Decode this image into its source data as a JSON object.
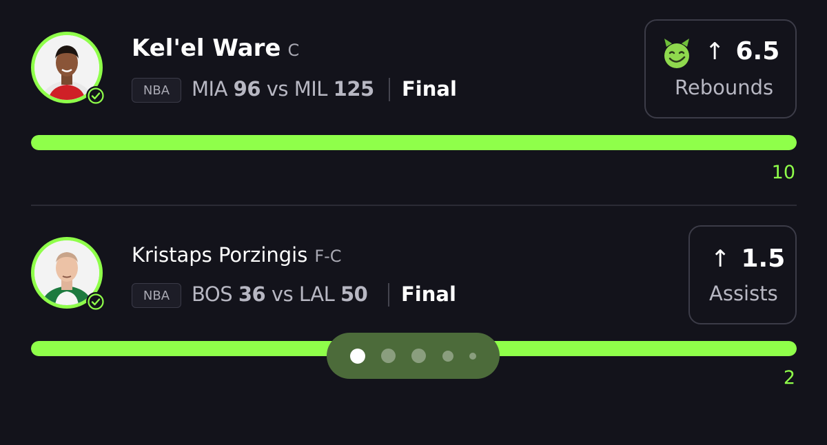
{
  "cards": [
    {
      "player": "Kel'el Ware",
      "position": "C",
      "league": "NBA",
      "team1": "MIA",
      "score1": "96",
      "vs": "vs",
      "team2": "MIL",
      "score2": "125",
      "status": "Final",
      "line": "6.5",
      "direction": "up-arrow-icon",
      "stat": "Rebounds",
      "has_emoji": true,
      "emoji_name": "smiling-devil-icon",
      "result": "10",
      "progress_fraction": 1.0
    },
    {
      "player": "Kristaps Porzingis",
      "position": "F-C",
      "league": "NBA",
      "team1": "BOS",
      "score1": "36",
      "vs": "vs",
      "team2": "LAL",
      "score2": "50",
      "status": "Final",
      "line": "1.5",
      "direction": "up-arrow-icon",
      "stat": "Assists",
      "has_emoji": false,
      "result": "2",
      "progress_fraction": 1.0
    }
  ],
  "pager": {
    "count": 5,
    "active_index": 0
  },
  "colors": {
    "background": "#13131b",
    "accent_green": "#8fff4a",
    "pager_bg": "#4c6b3a",
    "text_secondary": "#b7b7c2"
  },
  "symbols": {
    "arrow": "↑"
  }
}
